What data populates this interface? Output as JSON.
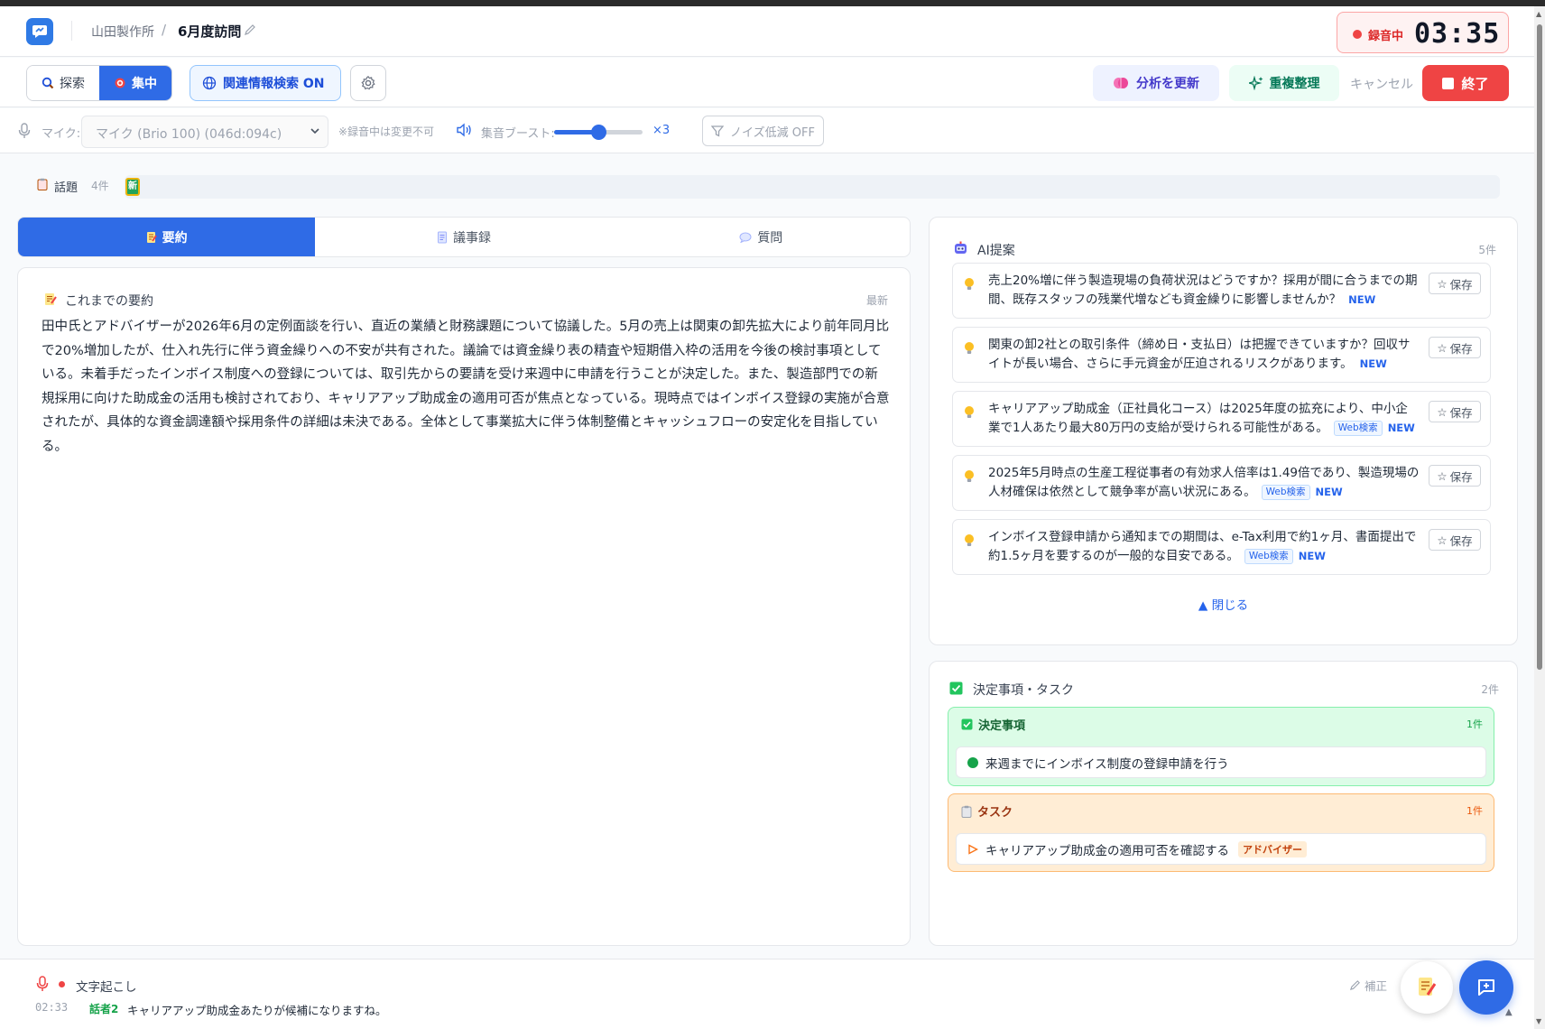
{
  "header": {
    "company": "山田製作所",
    "separator": "/",
    "title": "6月度訪問",
    "recording_label": "録音中",
    "recording_time": "03:35"
  },
  "toolbar": {
    "mode_explore": "探索",
    "mode_focus": "集中",
    "related_search": "関連情報検索 ON",
    "analyze": "分析を更新",
    "dedupe": "重複整理",
    "cancel": "キャンセル",
    "end": "終了"
  },
  "mic": {
    "label": "マイク:",
    "device": "マイク (Brio 100) (046d:094c)",
    "note": "※録音中は変更不可",
    "boost_label": "集音ブースト:",
    "boost_value": "×3",
    "boost_level": 0.5,
    "noise": "ノイズ低減 OFF"
  },
  "topics": {
    "label": "話題",
    "count": "4件",
    "chip": "新"
  },
  "tabs": [
    {
      "label": "要約"
    },
    {
      "label": "議事録"
    },
    {
      "label": "質問"
    }
  ],
  "summary": {
    "title": "これまでの要約",
    "latest": "最新",
    "body": "田中氏とアドバイザーが2026年6月の定例面談を行い、直近の業績と財務課題について協議した。5月の売上は関東の卸先拡大により前年同月比で20%増加したが、仕入れ先行に伴う資金繰りへの不安が共有された。議論では資金繰り表の精査や短期借入枠の活用を今後の検討事項としている。未着手だったインボイス制度への登録については、取引先からの要請を受け来週中に申請を行うことが決定した。また、製造部門での新規採用に向けた助成金の活用も検討されており、キャリアアップ助成金の適用可否が焦点となっている。現時点ではインボイス登録の実施が合意されたが、具体的な資金調達額や採用条件の詳細は未決である。全体として事業拡大に伴う体制整備とキャッシュフローの安定化を目指している。"
  },
  "ai": {
    "title": "AI提案",
    "count": "5件",
    "save_label": "保存",
    "web_label": "Web検索",
    "new_label": "NEW",
    "close_label": "▲ 閉じる",
    "items": [
      {
        "text": "売上20%増に伴う製造現場の負荷状況はどうですか？採用が間に合うまでの期間、既存スタッフの残業代増なども資金繰りに影響しませんか？"
      },
      {
        "text": "関東の卸2社との取引条件（締め日・支払日）は把握できていますか？回収サイトが長い場合、さらに手元資金が圧迫されるリスクがあります。"
      },
      {
        "text": "キャリアアップ助成金（正社員化コース）は2025年度の拡充により、中小企業で1人あたり最大80万円の支給が受けられる可能性がある。"
      },
      {
        "text": "2025年5月時点の生産工程従事者の有効求人倍率は1.49倍であり、製造現場の人材確保は依然として競争率が高い状況にある。"
      },
      {
        "text": "インボイス登録申請から通知までの期間は、e-Tax利用で約1ヶ月、書面提出で約1.5ヶ月を要するのが一般的な目安である。"
      }
    ]
  },
  "decisions": {
    "title": "決定事項・タスク",
    "count": "2件",
    "decided_label": "決定事項",
    "decided_count": "1件",
    "decided_item": "来週までにインボイス制度の登録申請を行う",
    "task_label": "タスク",
    "task_count": "1件",
    "task_item": "キャリアアップ助成金の適用可否を確認する",
    "task_assignee": "アドバイザー"
  },
  "transcript": {
    "title": "文字起こし",
    "fix_label": "補正",
    "time": "02:33",
    "speaker": "話者2",
    "text": "キャリアアップ助成金あたりが候補になりますね。"
  },
  "colors": {
    "accent": "#2f6be6",
    "danger": "#ef4444",
    "success": "#16a34a"
  }
}
